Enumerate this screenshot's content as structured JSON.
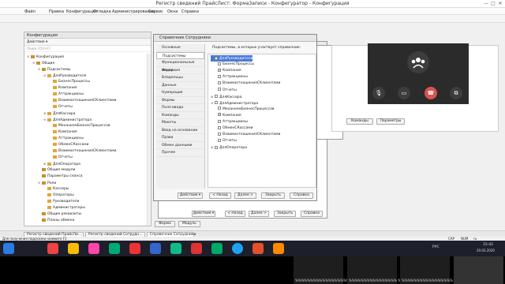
{
  "window": {
    "title": "Регистр сведений ПрайсЛист: ФормаЗаписи - Конфигуратор - Конфигурация",
    "controls": [
      "—",
      "□",
      "✕"
    ]
  },
  "menu": [
    "Файл",
    "Правка",
    "Конфигурация",
    "Отладка",
    "Администрирование",
    "Сервис",
    "Окна",
    "Справка"
  ],
  "config_panel": {
    "title": "Конфигурация",
    "actions_label": "Действия ▾",
    "search_placeholder": "Поиск (Ctrl+F)",
    "tree": [
      {
        "level": 0,
        "label": "Конфигурация",
        "expanded": true
      },
      {
        "level": 1,
        "label": "Общие",
        "expanded": true
      },
      {
        "level": 2,
        "label": "Подсистемы",
        "expanded": true
      },
      {
        "level": 3,
        "label": "ДляРуководителя",
        "expanded": true
      },
      {
        "level": 4,
        "label": "БизнесПроцессы"
      },
      {
        "level": 4,
        "label": "Компания"
      },
      {
        "level": 4,
        "label": "Аттракционы"
      },
      {
        "level": 4,
        "label": "ВзаимоотношенияСКлиентами"
      },
      {
        "level": 4,
        "label": "Отчеты"
      },
      {
        "level": 3,
        "label": "ДляКассира",
        "expanded": false
      },
      {
        "level": 3,
        "label": "ДляАдминистратора",
        "expanded": true
      },
      {
        "level": 4,
        "label": "МеханизмБизнесПроцессов"
      },
      {
        "level": 4,
        "label": "Компания"
      },
      {
        "level": 4,
        "label": "Аттракционы"
      },
      {
        "level": 4,
        "label": "ОбменСКассами"
      },
      {
        "level": 4,
        "label": "ВзаимоотношенияСКлиентами"
      },
      {
        "level": 4,
        "label": "Отчеты"
      },
      {
        "level": 3,
        "label": "ДляОператора",
        "expanded": false
      },
      {
        "level": 2,
        "label": "Общие модули"
      },
      {
        "level": 2,
        "label": "Параметры сеанса"
      },
      {
        "level": 2,
        "label": "Роли",
        "expanded": true
      },
      {
        "level": 3,
        "label": "Кассиры"
      },
      {
        "level": 3,
        "label": "Операторы"
      },
      {
        "level": 3,
        "label": "Руководители"
      },
      {
        "level": 3,
        "label": "Администраторы"
      },
      {
        "level": 2,
        "label": "Общие реквизиты"
      },
      {
        "level": 2,
        "label": "Планы обмена"
      }
    ]
  },
  "back_dialog": {
    "buttons": [
      "Действия ▾",
      "< Назад",
      "Далее >",
      "Закрыть",
      "Справка"
    ]
  },
  "middle_dialog": {
    "tabs": [
      "Команды",
      "Параметры"
    ]
  },
  "subsystems_dialog": {
    "title": "Справочник Сотрудники",
    "nav": [
      "Основные",
      "Подсистемы",
      "Функциональные опции",
      "Иерархия",
      "Владельцы",
      "Данные",
      "Нумерация",
      "Формы",
      "Поля ввода",
      "Команды",
      "Макеты",
      "Ввод на основании",
      "Права",
      "Обмен данными",
      "Прочее"
    ],
    "selected_nav": 1,
    "heading": "Подсистемы, в которых участвует справочник:",
    "tree": [
      {
        "level": 0,
        "label": "ДляРуководителя",
        "checked": false,
        "expanded": true,
        "highlight": true
      },
      {
        "level": 1,
        "label": "БизнесПроцессы",
        "checked": false
      },
      {
        "level": 1,
        "label": "Компания",
        "checked": true
      },
      {
        "level": 1,
        "label": "Аттракционы",
        "checked": false
      },
      {
        "level": 1,
        "label": "ВзаимоотношенияСКлиентами",
        "checked": false
      },
      {
        "level": 1,
        "label": "Отчеты",
        "checked": false
      },
      {
        "level": 0,
        "label": "ДляКассира",
        "checked": false,
        "expanded": false
      },
      {
        "level": 0,
        "label": "ДляАдминистратора",
        "checked": false,
        "expanded": true
      },
      {
        "level": 1,
        "label": "МеханизмБизнесПроцессов",
        "checked": false
      },
      {
        "level": 1,
        "label": "Компания",
        "checked": true
      },
      {
        "level": 1,
        "label": "Аттракционы",
        "checked": false
      },
      {
        "level": 1,
        "label": "ОбменСКассами",
        "checked": false
      },
      {
        "level": 1,
        "label": "ВзаимоотношенияСКлиентами",
        "checked": false
      },
      {
        "level": 1,
        "label": "Отчеты",
        "checked": false
      },
      {
        "level": 0,
        "label": "ДляОператора",
        "checked": false,
        "expanded": false
      }
    ],
    "buttons": [
      "Действия ▾",
      "< Назад",
      "Далее >",
      "Закрыть",
      "Справка"
    ]
  },
  "form_tabs": [
    "Форма",
    "Модуль"
  ],
  "open_windows": [
    "Регистр сведений ПрайсЛи...",
    "Регистр сведений Сотрудн...",
    "Справочник Сотрудники"
  ],
  "status": "Для получения подсказки нажмите F1",
  "status_right": [
    "CAP",
    "NUM",
    "ru"
  ],
  "call": {
    "buttons": [
      "mic-icon",
      "camera-icon",
      "hangup-icon",
      "share-icon"
    ]
  },
  "taskbar": {
    "time": "15:42",
    "date": "20.03.2020",
    "lang": "РУС"
  },
  "participants": [
    {
      "label": "%%%%%%%%%%%%%%%%%% %..."
    },
    {
      "label": "%%%%%%%%%%%%%%%% %%..."
    },
    {
      "label": "%%%%%%%%%%%%%%%%%..."
    }
  ],
  "colors": {
    "taskbar": "#1d1f2b",
    "call_bg": "#2b2b2b",
    "hangup": "#d9534f",
    "highlight": "#4a7bd6"
  }
}
